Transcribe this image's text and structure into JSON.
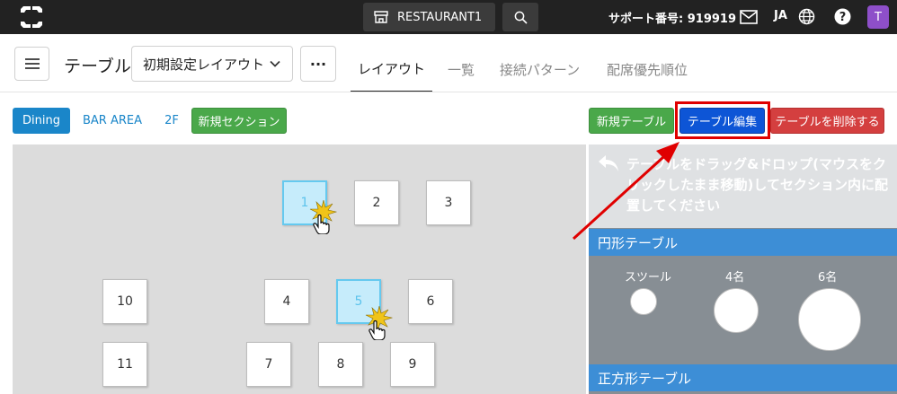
{
  "header": {
    "store_name": "RESTAURANT1",
    "support_text": "サポート番号: 919919",
    "language": "JA",
    "avatar_initial": "T"
  },
  "toolbar": {
    "page_title": "テーブル",
    "layout_select_value": "初期設定レイアウト",
    "more_label": "···"
  },
  "tabs": [
    {
      "label": "レイアウト",
      "active": true
    },
    {
      "label": "一覧",
      "active": false
    },
    {
      "label": "接続パターン",
      "active": false
    },
    {
      "label": "配席優先順位",
      "active": false
    }
  ],
  "sections": {
    "dining": "Dining",
    "bar_area": "BAR AREA",
    "second_floor": "2F",
    "new_section": "新規セクション"
  },
  "actions": {
    "new_table": "新規テーブル",
    "edit_table": "テーブル編集",
    "delete_table": "テーブルを削除する"
  },
  "tables": [
    {
      "label": "1",
      "selected": true
    },
    {
      "label": "2",
      "selected": false
    },
    {
      "label": "3",
      "selected": false
    },
    {
      "label": "10",
      "selected": false
    },
    {
      "label": "4",
      "selected": false
    },
    {
      "label": "5",
      "selected": true
    },
    {
      "label": "6",
      "selected": false
    },
    {
      "label": "11",
      "selected": false
    },
    {
      "label": "7",
      "selected": false
    },
    {
      "label": "8",
      "selected": false
    },
    {
      "label": "9",
      "selected": false
    }
  ],
  "panel": {
    "help_text": "テーブルをドラッグ&ドロップ(マウスをクリックしたまま移動)してセクション内に配置してください",
    "round_header": "円形テーブル",
    "round_options": [
      "スツール",
      "4名",
      "6名"
    ],
    "square_header": "正方形テーブル"
  },
  "colors": {
    "topbar": "#222222",
    "accent_blue": "#1a86c9",
    "green": "#4aa84a",
    "edit_blue": "#0d55d6",
    "red": "#d43f3f",
    "highlight": "#e00000",
    "selected_table": "#c6ecfb"
  },
  "icons": {
    "logo": "app-logo-icon",
    "store": "storefront-icon",
    "search": "search-icon",
    "mail": "mail-icon",
    "globe": "globe-icon",
    "help": "help-icon",
    "menu": "hamburger-menu-icon",
    "chevron": "chevron-down-icon",
    "undo": "undo-arrow-icon",
    "cursor": "hand-pointer-icon"
  }
}
